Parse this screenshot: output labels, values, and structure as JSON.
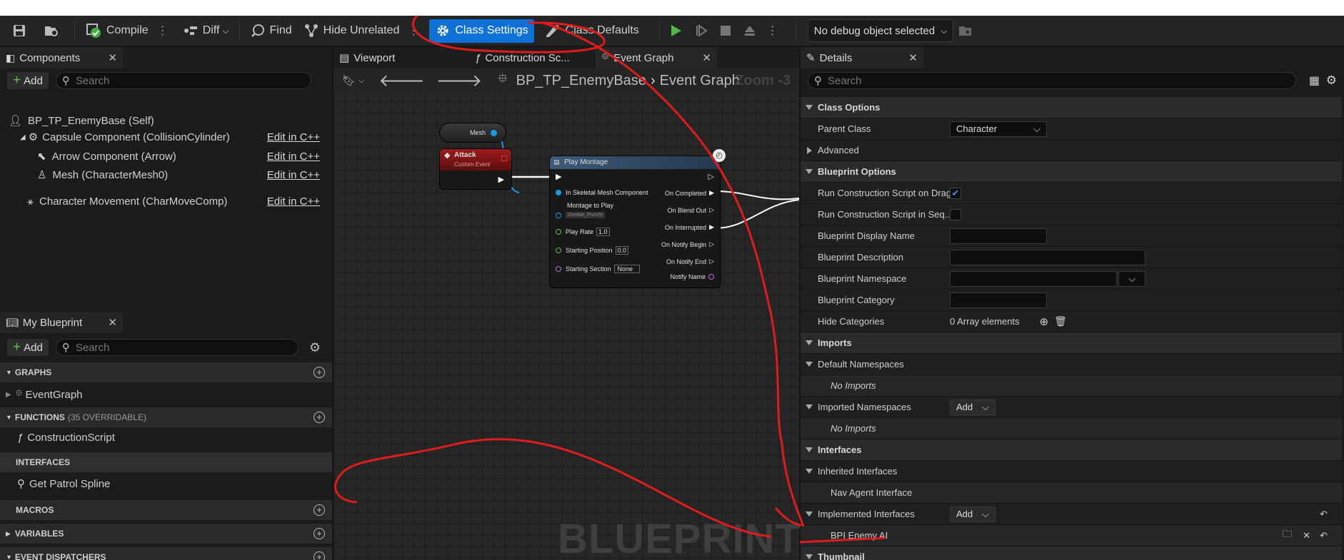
{
  "toolbar": {
    "compile": "Compile",
    "diff": "Diff",
    "find": "Find",
    "hide_unrelated": "Hide Unrelated",
    "class_settings": "Class Settings",
    "class_defaults": "Class Defaults",
    "debug_object": "No debug object selected"
  },
  "components": {
    "tab": "Components",
    "add": "Add",
    "search_placeholder": "Search",
    "root": "BP_TP_EnemyBase (Self)",
    "items": [
      {
        "label": "Capsule Component (CollisionCylinder)",
        "edit": "Edit in C++"
      },
      {
        "label": "Arrow Component (Arrow)",
        "edit": "Edit in C++"
      },
      {
        "label": "Mesh (CharacterMesh0)",
        "edit": "Edit in C++"
      },
      {
        "label": "Character Movement (CharMoveComp)",
        "edit": "Edit in C++"
      }
    ]
  },
  "my_blueprint": {
    "tab": "My Blueprint",
    "add": "Add",
    "search_placeholder": "Search",
    "graphs": "GRAPHS",
    "event_graph": "EventGraph",
    "functions": "FUNCTIONS",
    "functions_count": "(35 OVERRIDABLE)",
    "construction_script": "ConstructionScript",
    "interfaces": "INTERFACES",
    "get_patrol_spline": "Get Patrol Spline",
    "macros": "MACROS",
    "variables": "VARIABLES",
    "event_dispatchers": "EVENT DISPATCHERS"
  },
  "graph_tabs": {
    "viewport": "Viewport",
    "construction": "Construction Sc...",
    "event_graph": "Event Graph"
  },
  "graph": {
    "blueprint_name": "BP_TP_EnemyBase",
    "graph_name": "Event Graph",
    "zoom": "Zoom -3",
    "watermark": "BLUEPRINT",
    "mesh_node": "Mesh",
    "attack_title": "Attack",
    "attack_subtitle": "Custom Event",
    "montage_title": "Play Montage",
    "in_skeletal": "In Skeletal Mesh Component",
    "montage_to_play": "Montage to Play",
    "montage_value": "Zombie_Punchi",
    "play_rate": "Play Rate",
    "play_rate_value": "1.0",
    "starting_position": "Starting Position",
    "starting_position_value": "0.0",
    "starting_section": "Starting Section",
    "starting_section_value": "None",
    "on_completed": "On Completed",
    "on_blend_out": "On Blend Out",
    "on_interrupted": "On Interrupted",
    "on_notify_begin": "On Notify Begin",
    "on_notify_end": "On Notify End",
    "notify_name": "Notify Name"
  },
  "details": {
    "tab": "Details",
    "search_placeholder": "Search",
    "class_options": "Class Options",
    "parent_class": "Parent Class",
    "parent_class_value": "Character",
    "advanced": "Advanced",
    "blueprint_options": "Blueprint Options",
    "run_cs_on_drag": "Run Construction Script on Drag",
    "run_cs_in_seq": "Run Construction Script in Seq...",
    "display_name": "Blueprint Display Name",
    "description": "Blueprint Description",
    "namespace": "Blueprint Namespace",
    "category": "Blueprint Category",
    "hide_categories": "Hide Categories",
    "array_elements": "0 Array elements",
    "imports": "Imports",
    "default_namespaces": "Default Namespaces",
    "no_imports": "No Imports",
    "imported_namespaces": "Imported Namespaces",
    "add": "Add",
    "interfaces": "Interfaces",
    "inherited_interfaces": "Inherited Interfaces",
    "nav_agent_interface": "Nav Agent Interface",
    "implemented_interfaces": "Implemented Interfaces",
    "bpi_enemy_ai": "BPI Enemy AI",
    "thumbnail": "Thumbnail"
  },
  "colors": {
    "accent": "#0f71d6",
    "annotation": "#e01b1b",
    "pin_exec": "#ffffff",
    "pin_object": "#1a9be0",
    "pin_float": "#5ec24f",
    "pin_name": "#c06ad9"
  }
}
